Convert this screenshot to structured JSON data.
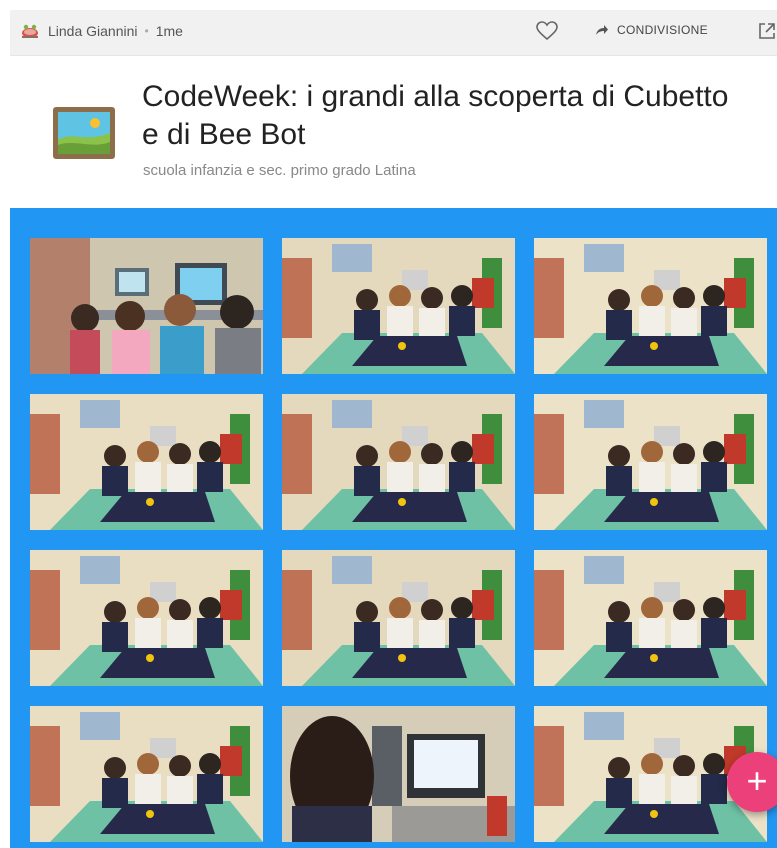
{
  "post": {
    "author": "Linda Giannini",
    "separator": "•",
    "time": "1me",
    "share_label": "CONDIVISIONE",
    "title": "CodeWeek: i grandi alla scoperta di Cubetto e di Bee Bot",
    "subtitle": "scuola infanzia e sec. primo grado Latina"
  },
  "icons": {
    "avatar": "crab-avatar-icon",
    "like": "heart-icon",
    "share": "share-arrow-icon",
    "open": "open-external-icon",
    "header": "image-gallery-icon",
    "fab": "plus-icon"
  },
  "colors": {
    "gallery_bg": "#2196f3",
    "fab": "#ec407a",
    "topbar": "#f1f1f1"
  },
  "fab_label": "+",
  "photos": [
    {
      "alt": "computer-lab-kids"
    },
    {
      "alt": "coding-mat-group"
    },
    {
      "alt": "coding-mat-group"
    },
    {
      "alt": "classroom-coding-mat"
    },
    {
      "alt": "coding-mat-group"
    },
    {
      "alt": "coding-mat-group"
    },
    {
      "alt": "coding-mat-closeup"
    },
    {
      "alt": "coding-mat-group"
    },
    {
      "alt": "coding-mat-group"
    },
    {
      "alt": "classroom-coding-mat"
    },
    {
      "alt": "girl-at-computer"
    },
    {
      "alt": "coding-mat-table"
    }
  ]
}
